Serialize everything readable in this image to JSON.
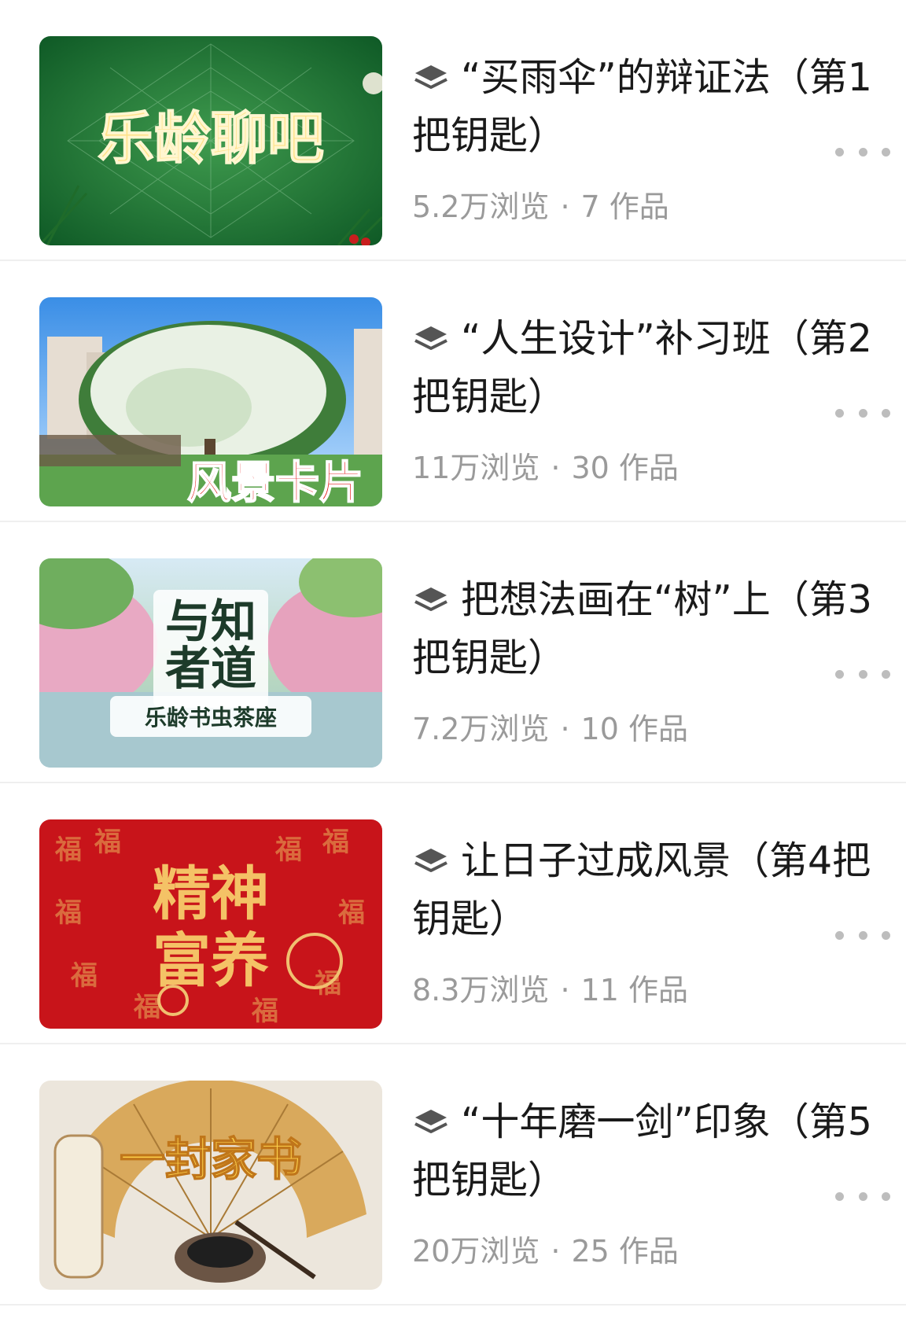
{
  "items": [
    {
      "title": "“买雨伞”的辩证法（第1把钥匙）",
      "views": "5.2万浏览",
      "works": "7 作品",
      "thumb_text": "乐龄聊吧"
    },
    {
      "title": "“人生设计”补习班（第2把钥匙）",
      "views": "11万浏览",
      "works": "30 作品",
      "thumb_text": "风景卡片"
    },
    {
      "title": "把想法画在“树”上（第3把钥匙）",
      "views": "7.2万浏览",
      "works": "10 作品",
      "thumb_text_line1": "与知",
      "thumb_text_line2": "者道",
      "thumb_subtitle": "乐龄书虫茶座"
    },
    {
      "title": "让日子过成风景（第4把钥匙）",
      "views": "8.3万浏览",
      "works": "11 作品",
      "thumb_text_line1": "精神",
      "thumb_text_line2": "富养"
    },
    {
      "title": "“十年磨一剑”印象（第5把钥匙）",
      "views": "20万浏览",
      "works": "25 作品",
      "thumb_text": "一封家书"
    }
  ],
  "separator": "·",
  "icons": {
    "collection": "stack-layers-icon",
    "more": "more-dots-icon"
  }
}
